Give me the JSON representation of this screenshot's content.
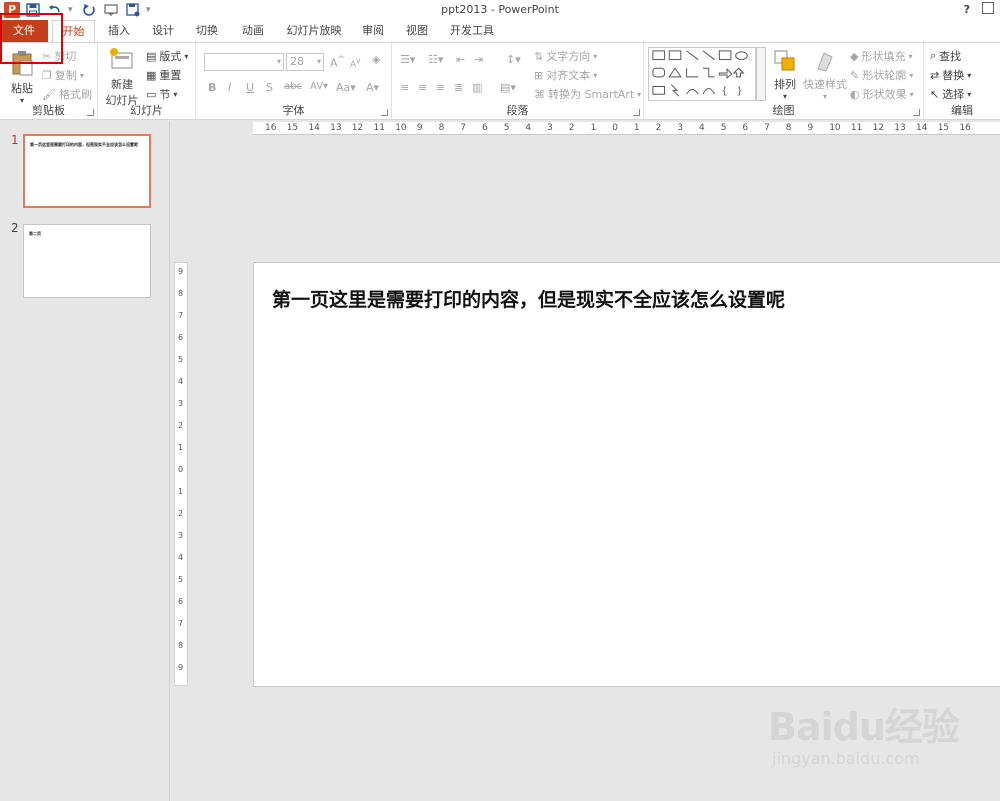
{
  "window": {
    "title": "ppt2013 - PowerPoint",
    "app_logo": "P",
    "help": "?"
  },
  "tabs": [
    "文件",
    "开始",
    "插入",
    "设计",
    "切换",
    "动画",
    "幻灯片放映",
    "审阅",
    "视图",
    "开发工具"
  ],
  "ribbon": {
    "clipboard": {
      "label": "剪贴板",
      "paste": "粘贴",
      "cut": "剪切",
      "copy": "复制",
      "format_painter": "格式刷"
    },
    "slides": {
      "label": "幻灯片",
      "new_slide_line1": "新建",
      "new_slide_line2": "幻灯片",
      "layout": "版式",
      "reset": "重置",
      "section": "节"
    },
    "font": {
      "label": "字体",
      "font_name": "",
      "font_size": "28",
      "bold": "B",
      "italic": "I",
      "underline": "U",
      "shadow": "S",
      "strikethrough": "abc",
      "spacing": "AV",
      "case": "Aa",
      "color": "A",
      "grow": "A",
      "shrink": "A"
    },
    "paragraph": {
      "label": "段落",
      "text_direction": "文字方向",
      "align_text": "对齐文本",
      "convert_smartart": "转换为 SmartArt"
    },
    "drawing": {
      "label": "绘图",
      "arrange": "排列",
      "quick_styles": "快速样式",
      "shape_fill": "形状填充",
      "shape_outline": "形状轮廓",
      "shape_effects": "形状效果"
    },
    "editing": {
      "label": "编辑",
      "find": "查找",
      "replace": "替换",
      "select": "选择"
    }
  },
  "ruler_h": [
    "16",
    "15",
    "14",
    "13",
    "12",
    "11",
    "10",
    "9",
    "8",
    "7",
    "6",
    "5",
    "4",
    "3",
    "2",
    "1",
    "0",
    "1",
    "2",
    "3",
    "4",
    "5",
    "6",
    "7",
    "8",
    "9",
    "10",
    "11",
    "12",
    "13",
    "14",
    "15",
    "16"
  ],
  "ruler_v": [
    "9",
    "8",
    "7",
    "6",
    "5",
    "4",
    "3",
    "2",
    "1",
    "0",
    "1",
    "2",
    "3",
    "4",
    "5",
    "6",
    "7",
    "8",
    "9"
  ],
  "thumbnails": [
    {
      "number": "1",
      "text": "第一页这里是需要打印的内容，但是现实不全应该怎么设置呢"
    },
    {
      "number": "2",
      "text": "第二页"
    }
  ],
  "slide": {
    "text": "第一页这里是需要打印的内容，但是现实不全应该怎么设置呢"
  },
  "watermark": {
    "logo": "Baidu经验",
    "url": "jingyan.baidu.com"
  },
  "colors": {
    "accent": "#c43e1c",
    "highlight": "#e10000",
    "selected_thumb": "#e8765a"
  }
}
